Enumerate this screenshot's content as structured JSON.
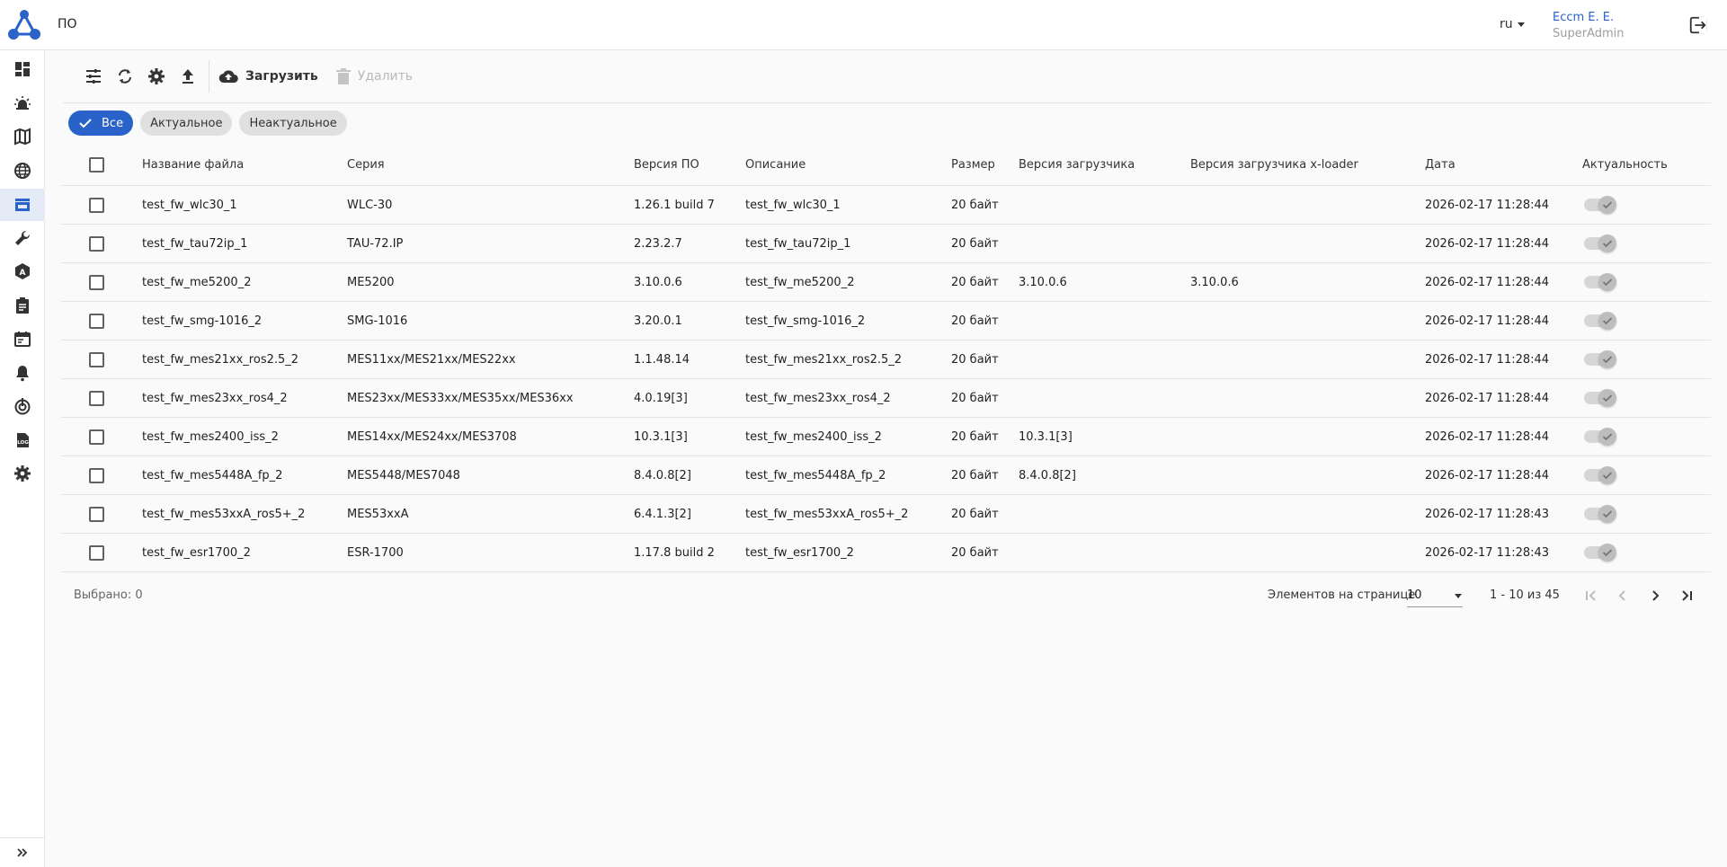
{
  "header": {
    "title": "ПО",
    "lang": "ru",
    "user_name": "Eccm E. E.",
    "user_role": "SuperAdmin"
  },
  "toolbar": {
    "upload_label": "Загрузить",
    "delete_label": "Удалить"
  },
  "filters": [
    "Все",
    "Актуальное",
    "Неактуальное"
  ],
  "table": {
    "columns": [
      "Название файла",
      "Серия",
      "Версия ПО",
      "Описание",
      "Размер",
      "Версия загрузчика",
      "Версия загрузчика x-loader",
      "Дата",
      "Актуальность"
    ],
    "rows": [
      {
        "name": "test_fw_wlc30_1",
        "series": "WLC-30",
        "version": "1.26.1 build 7",
        "desc": "test_fw_wlc30_1",
        "size": "20 байт",
        "boot": "",
        "xloader": "",
        "date": "2026-02-17 11:28:44"
      },
      {
        "name": "test_fw_tau72ip_1",
        "series": "TAU-72.IP",
        "version": "2.23.2.7",
        "desc": "test_fw_tau72ip_1",
        "size": "20 байт",
        "boot": "",
        "xloader": "",
        "date": "2026-02-17 11:28:44"
      },
      {
        "name": "test_fw_me5200_2",
        "series": "ME5200",
        "version": "3.10.0.6",
        "desc": "test_fw_me5200_2",
        "size": "20 байт",
        "boot": "3.10.0.6",
        "xloader": "3.10.0.6",
        "date": "2026-02-17 11:28:44"
      },
      {
        "name": "test_fw_smg-1016_2",
        "series": "SMG-1016",
        "version": "3.20.0.1",
        "desc": "test_fw_smg-1016_2",
        "size": "20 байт",
        "boot": "",
        "xloader": "",
        "date": "2026-02-17 11:28:44"
      },
      {
        "name": "test_fw_mes21xx_ros2.5_2",
        "series": "MES11xx/MES21xx/MES22xx",
        "version": "1.1.48.14",
        "desc": "test_fw_mes21xx_ros2.5_2",
        "size": "20 байт",
        "boot": "",
        "xloader": "",
        "date": "2026-02-17 11:28:44"
      },
      {
        "name": "test_fw_mes23xx_ros4_2",
        "series": "MES23xx/MES33xx/MES35xx/MES36xx",
        "version": "4.0.19[3]",
        "desc": "test_fw_mes23xx_ros4_2",
        "size": "20 байт",
        "boot": "",
        "xloader": "",
        "date": "2026-02-17 11:28:44"
      },
      {
        "name": "test_fw_mes2400_iss_2",
        "series": "MES14xx/MES24xx/MES3708",
        "version": "10.3.1[3]",
        "desc": "test_fw_mes2400_iss_2",
        "size": "20 байт",
        "boot": "10.3.1[3]",
        "xloader": "",
        "date": "2026-02-17 11:28:44"
      },
      {
        "name": "test_fw_mes5448A_fp_2",
        "series": "MES5448/MES7048",
        "version": "8.4.0.8[2]",
        "desc": "test_fw_mes5448A_fp_2",
        "size": "20 байт",
        "boot": "8.4.0.8[2]",
        "xloader": "",
        "date": "2026-02-17 11:28:44"
      },
      {
        "name": "test_fw_mes53xxA_ros5+_2",
        "series": "MES53xxA",
        "version": "6.4.1.3[2]",
        "desc": "test_fw_mes53xxA_ros5+_2",
        "size": "20 байт",
        "boot": "",
        "xloader": "",
        "date": "2026-02-17 11:28:43"
      },
      {
        "name": "test_fw_esr1700_2",
        "series": "ESR-1700",
        "version": "1.17.8 build 2",
        "desc": "test_fw_esr1700_2",
        "size": "20 байт",
        "boot": "",
        "xloader": "",
        "date": "2026-02-17 11:28:43"
      }
    ]
  },
  "footer": {
    "selected": "Выбрано: 0",
    "per_page_label": "Элементов на странице",
    "per_page_value": "10",
    "range": "1 - 10 из 45"
  },
  "colors": {
    "accent": "#2962c8",
    "sidebar_active": "#e4ebf7"
  },
  "sidebar_icons": [
    "dashboard-icon",
    "alarm-icon",
    "map-icon",
    "globe-icon",
    "firmware-store-icon",
    "wrench-icon",
    "auto-icon",
    "clipboard-icon",
    "calendar-icon",
    "bell-icon",
    "power-target-icon",
    "log-icon",
    "gear-icon"
  ]
}
